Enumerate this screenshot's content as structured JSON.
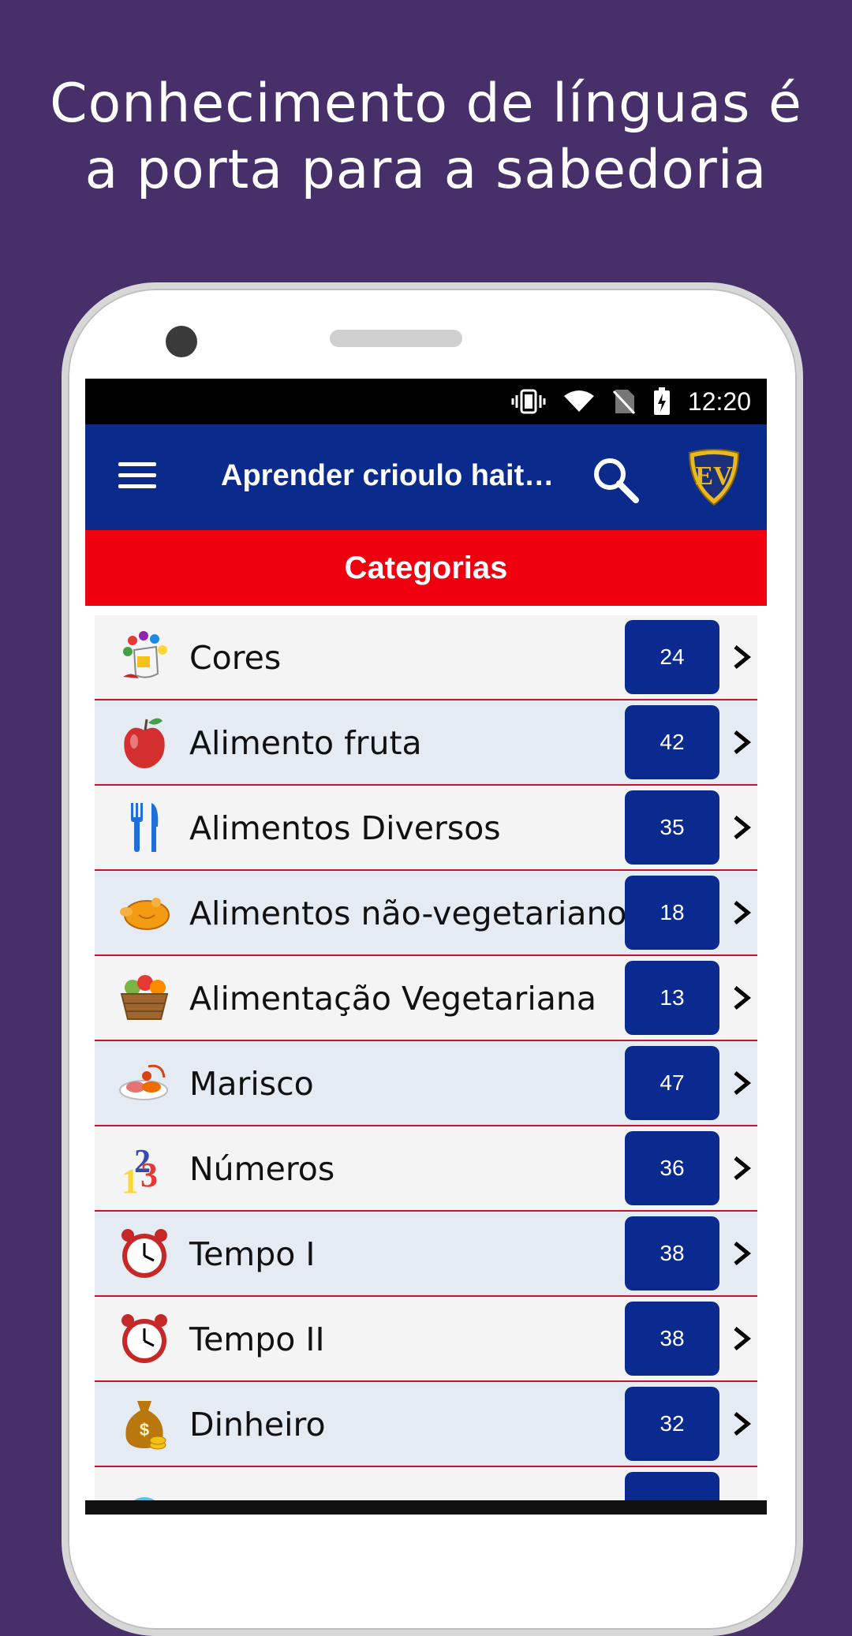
{
  "headline": {
    "line1": "Conhecimento de línguas é",
    "line2": "a porta para a sabedoria"
  },
  "status_bar": {
    "time": "12:20",
    "icons": [
      "vibrate-icon",
      "wifi-icon",
      "no-sim-icon",
      "battery-charging-icon"
    ]
  },
  "app_bar": {
    "title": "Aprender crioulo hait…",
    "menu_icon": "hamburger-menu-icon",
    "search_icon": "search-icon",
    "logo_text": "EV"
  },
  "category_header": "Categorias",
  "colors": {
    "background": "#47306a",
    "app_bar": "#0a2a8c",
    "category_bar": "#f0000e",
    "badge": "#0b2a8f",
    "divider": "#c8102e"
  },
  "categories": [
    {
      "label": "Cores",
      "count": "24",
      "icon": "paint-bucket-icon"
    },
    {
      "label": "Alimento fruta",
      "count": "42",
      "icon": "apple-icon"
    },
    {
      "label": "Alimentos Diversos",
      "count": "35",
      "icon": "fork-knife-icon"
    },
    {
      "label": "Alimentos não-vegetarianos",
      "count": "18",
      "icon": "roast-chicken-icon"
    },
    {
      "label": "Alimentação Vegetariana",
      "count": "13",
      "icon": "vegetable-basket-icon"
    },
    {
      "label": "Marisco",
      "count": "47",
      "icon": "seafood-icon"
    },
    {
      "label": "Números",
      "count": "36",
      "icon": "numbers-icon"
    },
    {
      "label": "Tempo I",
      "count": "38",
      "icon": "alarm-clock-icon"
    },
    {
      "label": "Tempo II",
      "count": "38",
      "icon": "alarm-clock-icon"
    },
    {
      "label": "Dinheiro",
      "count": "32",
      "icon": "money-bag-icon"
    },
    {
      "label": "",
      "count": "",
      "icon": "partial-icon"
    }
  ]
}
